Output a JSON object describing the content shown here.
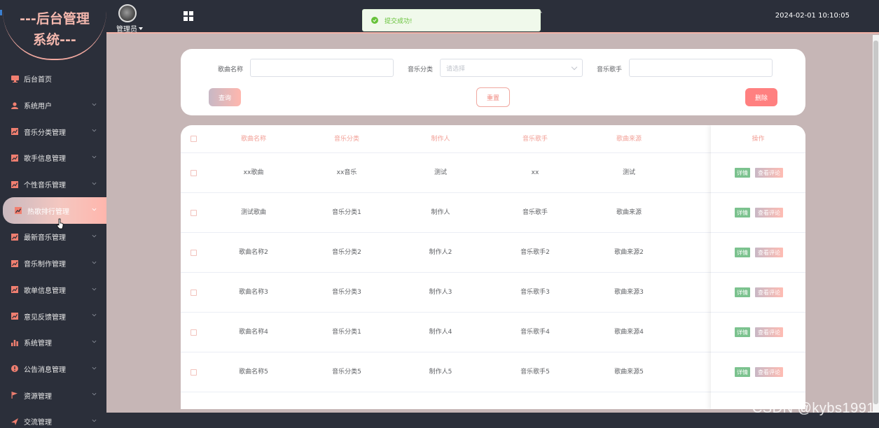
{
  "brand": {
    "title_line1": "---后台管理",
    "title_line2": "系统---"
  },
  "header": {
    "user_label": "管理员",
    "datetime": "2024-02-01 10:10:05"
  },
  "toast": {
    "message": "提交成功!"
  },
  "sidebar": {
    "items": [
      {
        "label": "后台首页",
        "icon": "monitor-icon",
        "has_children": false
      },
      {
        "label": "系统用户",
        "icon": "user-icon",
        "has_children": true
      },
      {
        "label": "音乐分类管理",
        "icon": "chart-line-icon",
        "has_children": true
      },
      {
        "label": "歌手信息管理",
        "icon": "chart-line-icon",
        "has_children": true
      },
      {
        "label": "个性音乐管理",
        "icon": "chart-line-icon",
        "has_children": true
      },
      {
        "label": "热歌排行管理",
        "icon": "chart-line-icon",
        "has_children": true,
        "active": true
      },
      {
        "label": "最新音乐管理",
        "icon": "chart-line-icon",
        "has_children": true
      },
      {
        "label": "音乐制作管理",
        "icon": "chart-line-icon",
        "has_children": true
      },
      {
        "label": "歌单信息管理",
        "icon": "chart-line-icon",
        "has_children": true
      },
      {
        "label": "意见反馈管理",
        "icon": "chart-line-icon",
        "has_children": true
      },
      {
        "label": "系统管理",
        "icon": "bar-chart-icon",
        "has_children": true
      },
      {
        "label": "公告消息管理",
        "icon": "info-icon",
        "has_children": true
      },
      {
        "label": "资源管理",
        "icon": "flag-icon",
        "has_children": true
      },
      {
        "label": "交流管理",
        "icon": "send-icon",
        "has_children": true
      }
    ]
  },
  "search": {
    "song_name_label": "歌曲名称",
    "song_name_value": "",
    "category_label": "音乐分类",
    "category_placeholder": "请选择",
    "singer_label": "音乐歌手",
    "singer_value": "",
    "query_label": "查询",
    "reset_label": "重置",
    "delete_label": "删除"
  },
  "table": {
    "columns": [
      "歌曲名称",
      "音乐分类",
      "制作人",
      "音乐歌手",
      "歌曲来源"
    ],
    "actions_header": "操作",
    "rows": [
      [
        "xx歌曲",
        "xx音乐",
        "测试",
        "xx",
        "测试"
      ],
      [
        "测试歌曲",
        "音乐分类1",
        "制作人",
        "音乐歌手",
        "歌曲来源"
      ],
      [
        "歌曲名称2",
        "音乐分类2",
        "制作人2",
        "音乐歌手2",
        "歌曲来源2"
      ],
      [
        "歌曲名称3",
        "音乐分类3",
        "制作人3",
        "音乐歌手3",
        "歌曲来源3"
      ],
      [
        "歌曲名称4",
        "音乐分类1",
        "制作人4",
        "音乐歌手4",
        "歌曲来源4"
      ],
      [
        "歌曲名称5",
        "音乐分类5",
        "制作人5",
        "音乐歌手5",
        "歌曲来源5"
      ]
    ],
    "detail_label": "详情",
    "review_label": "查看评论"
  },
  "watermark": "CSDN @kybs1991",
  "colors": {
    "sidebar_bg": "#2b2f3a",
    "accent": "#f2a097",
    "content_bg": "#c6b6b6",
    "success": "#67c23a",
    "danger": "#ff8080",
    "detail_green": "#7bc28e"
  }
}
